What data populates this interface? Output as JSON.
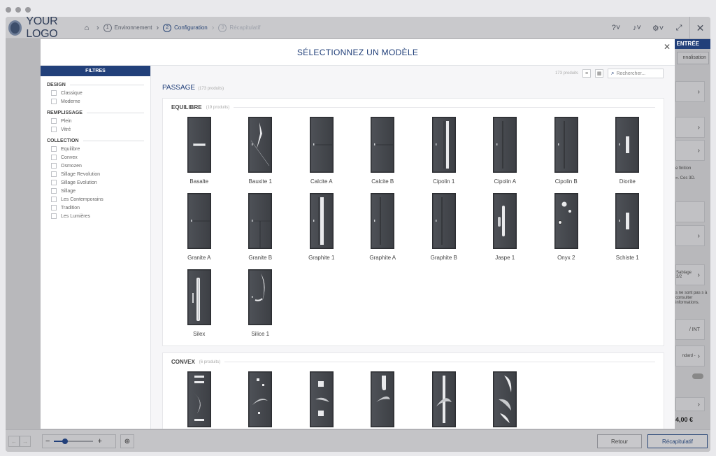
{
  "app": {
    "logo_text": "YOUR LOGO",
    "breadcrumbs": [
      {
        "num": "1",
        "label": "Environnement",
        "state": "done"
      },
      {
        "num": "2",
        "label": "Configuration",
        "state": "active"
      },
      {
        "num": "3",
        "label": "Récapitulatif",
        "state": "dim"
      }
    ],
    "icons": [
      "help-icon",
      "bell-icon",
      "gear-icon",
      "expand-icon",
      "close-icon"
    ]
  },
  "right_panel": {
    "header": "ENTRÉE",
    "tab": "nnalisation",
    "finish_text": "e finition",
    "ces_text": "». Ces 3D.",
    "sablage_text": "Sablage 3/2",
    "notice_text": "s ne sont pas s à consulter informations.",
    "ext_int": "/ INT",
    "standard": "ndard -",
    "price": "4,00 €"
  },
  "bottom": {
    "retour": "Retour",
    "recap": "Récapitulatif",
    "zoom_level": 0.28
  },
  "modal": {
    "title": "SÉLECTIONNEZ UN MODÈLE",
    "filters_title": "FILTRES",
    "filter_groups": [
      {
        "title": "DESIGN",
        "items": [
          "Classique",
          "Moderne"
        ]
      },
      {
        "title": "REMPLISSAGE",
        "items": [
          "Plein",
          "Vitré"
        ]
      },
      {
        "title": "COLLECTION",
        "items": [
          "Equilibre",
          "Convex",
          "Osmozen",
          "Sillage Revolution",
          "Sillage Evolution",
          "Sillage",
          "Les Contemporains",
          "Tradition",
          "Les Lumières"
        ]
      }
    ],
    "product_count": "173 produits",
    "search_placeholder": "Rechercher...",
    "section_title": "PASSAGE",
    "section_count": "(173 produits)",
    "groups": [
      {
        "title": "EQUILIBRE",
        "count": "(19 produits)",
        "doors": [
          {
            "name": "Basalte",
            "style": "handlebar"
          },
          {
            "name": "Bauxite 1",
            "style": "diagonal-glass"
          },
          {
            "name": "Calcite A",
            "style": "hline"
          },
          {
            "name": "Calcite B",
            "style": "hline"
          },
          {
            "name": "Cipolin 1",
            "style": "tall-glass"
          },
          {
            "name": "Cipolin A",
            "style": "tall-line"
          },
          {
            "name": "Cipolin B",
            "style": "tall-line"
          },
          {
            "name": "Diorite",
            "style": "mid-glass"
          },
          {
            "name": "Granite A",
            "style": "hline"
          },
          {
            "name": "Granite B",
            "style": "vline"
          },
          {
            "name": "Graphite 1",
            "style": "tall-glass-wide"
          },
          {
            "name": "Graphite A",
            "style": "tall-line"
          },
          {
            "name": "Graphite B",
            "style": "tall-line"
          },
          {
            "name": "Jaspe 1",
            "style": "oval-glass"
          },
          {
            "name": "Onyx 2",
            "style": "circles"
          },
          {
            "name": "Schiste 1",
            "style": "mid-glass"
          },
          {
            "name": "Silex",
            "style": "long-glass"
          },
          {
            "name": "Silice 1",
            "style": "crescent"
          }
        ]
      },
      {
        "title": "CONVEX",
        "count": "(6 produits)",
        "doors": [
          {
            "name": "",
            "style": "convex-1"
          },
          {
            "name": "",
            "style": "convex-2"
          },
          {
            "name": "",
            "style": "convex-3"
          },
          {
            "name": "",
            "style": "convex-4"
          },
          {
            "name": "",
            "style": "convex-5"
          },
          {
            "name": "",
            "style": "convex-6"
          }
        ]
      }
    ]
  }
}
